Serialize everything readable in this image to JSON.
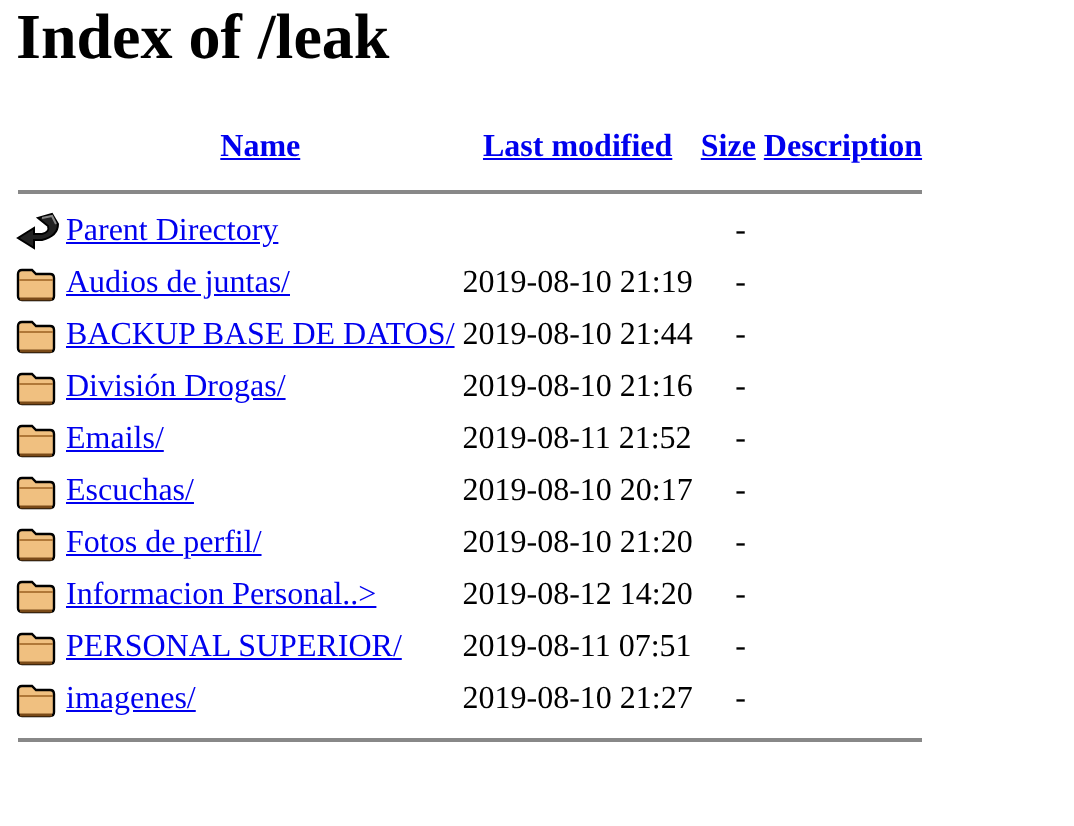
{
  "title": "Index of /leak",
  "columns": [
    {
      "label": "Name"
    },
    {
      "label": "Last modified"
    },
    {
      "label": "Size"
    },
    {
      "label": "Description"
    }
  ],
  "entries": [
    {
      "kind": "parent",
      "name": "Parent Directory",
      "size": "-"
    },
    {
      "kind": "folder",
      "name": "Audios de juntas/",
      "last_modified": "2019-08-10 21:19",
      "size": "-"
    },
    {
      "kind": "folder",
      "name": "BACKUP BASE DE DATOS/",
      "last_modified": "2019-08-10 21:44",
      "size": "-"
    },
    {
      "kind": "folder",
      "name": "División Drogas/",
      "last_modified": "2019-08-10 21:16",
      "size": "-"
    },
    {
      "kind": "folder",
      "name": "Emails/",
      "last_modified": "2019-08-11 21:52",
      "size": "-"
    },
    {
      "kind": "folder",
      "name": "Escuchas/",
      "last_modified": "2019-08-10 20:17",
      "size": "-"
    },
    {
      "kind": "folder",
      "name": "Fotos de perfil/",
      "last_modified": "2019-08-10 21:20",
      "size": "-"
    },
    {
      "kind": "folder",
      "name": "Informacion Personal..>",
      "last_modified": "2019-08-12 14:20",
      "size": "-"
    },
    {
      "kind": "folder",
      "name": "PERSONAL SUPERIOR/",
      "last_modified": "2019-08-11 07:51",
      "size": "-"
    },
    {
      "kind": "folder",
      "name": "imagenes/",
      "last_modified": "2019-08-10 21:27",
      "size": "-"
    }
  ]
}
